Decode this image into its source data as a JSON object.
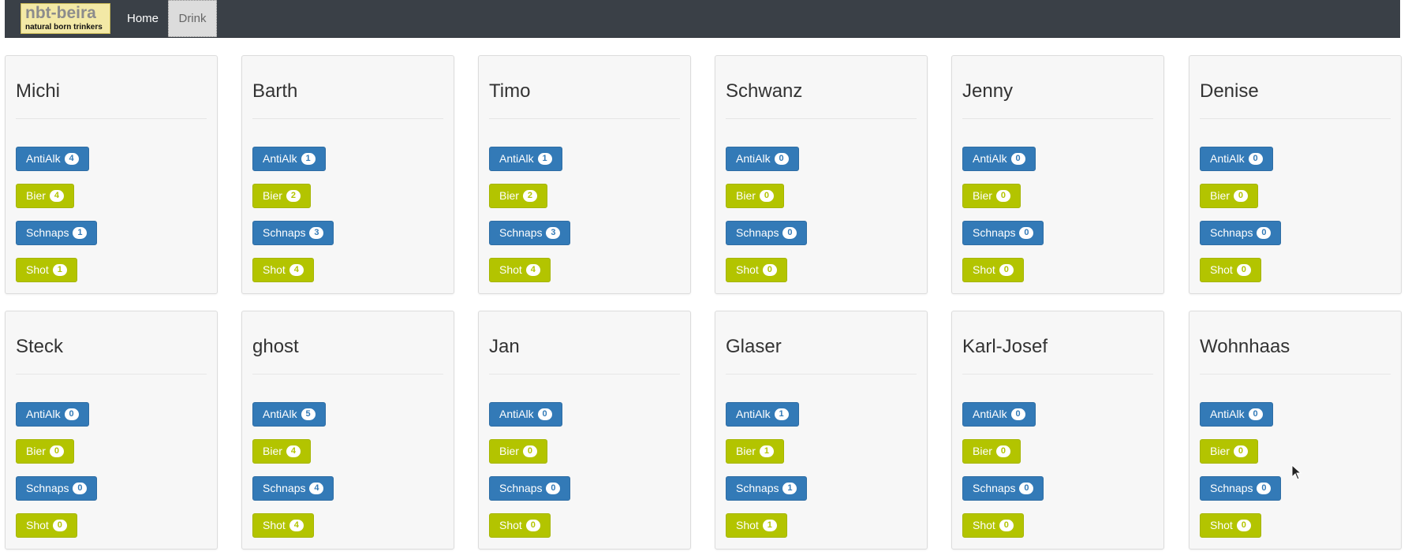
{
  "navbar": {
    "logo_title": "nbt-beira",
    "logo_subtitle": "natural born trinkers",
    "home_label": "Home",
    "drink_label": "Drink"
  },
  "colors": {
    "navbar": "#3a4047",
    "primary": "#337ab7",
    "success": "#b3c400"
  },
  "drink_labels": {
    "antialk": "AntiAlk",
    "bier": "Bier",
    "schnaps": "Schnaps",
    "shot": "Shot"
  },
  "people": [
    {
      "name": "Michi",
      "antialk": "4",
      "bier": "4",
      "schnaps": "1",
      "shot": "1"
    },
    {
      "name": "Barth",
      "antialk": "1",
      "bier": "2",
      "schnaps": "3",
      "shot": "4"
    },
    {
      "name": "Timo",
      "antialk": "1",
      "bier": "2",
      "schnaps": "3",
      "shot": "4"
    },
    {
      "name": "Schwanz",
      "antialk": "0",
      "bier": "0",
      "schnaps": "0",
      "shot": "0"
    },
    {
      "name": "Jenny",
      "antialk": "0",
      "bier": "0",
      "schnaps": "0",
      "shot": "0"
    },
    {
      "name": "Denise",
      "antialk": "0",
      "bier": "0",
      "schnaps": "0",
      "shot": "0"
    },
    {
      "name": "Steck",
      "antialk": "0",
      "bier": "0",
      "schnaps": "0",
      "shot": "0"
    },
    {
      "name": "ghost",
      "antialk": "5",
      "bier": "4",
      "schnaps": "4",
      "shot": "4"
    },
    {
      "name": "Jan",
      "antialk": "0",
      "bier": "0",
      "schnaps": "0",
      "shot": "0"
    },
    {
      "name": "Glaser",
      "antialk": "1",
      "bier": "1",
      "schnaps": "1",
      "shot": "1"
    },
    {
      "name": "Karl-Josef",
      "antialk": "0",
      "bier": "0",
      "schnaps": "0",
      "shot": "0"
    },
    {
      "name": "Wohnhaas",
      "antialk": "0",
      "bier": "0",
      "schnaps": "0",
      "shot": "0"
    }
  ]
}
